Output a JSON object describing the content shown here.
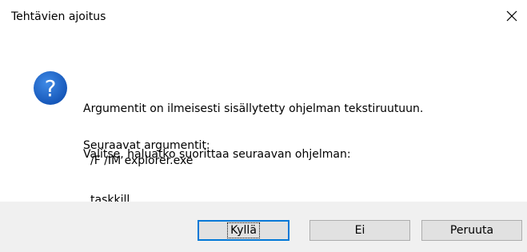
{
  "window": {
    "title": "Tehtävien ajoitus",
    "close_icon": "close-icon"
  },
  "message": {
    "icon": "question-icon",
    "line1": "Argumentit on ilmeisesti sisällytetty ohjelman tekstiruutuun.",
    "line2": "Valitse, haluatko suorittaa seuraavan ohjelman:",
    "program": "taskkill",
    "args_label": "Seuraavat argumentit:",
    "args_value": "/F /IM explorer.exe"
  },
  "buttons": {
    "yes": "Kyllä",
    "no": "Ei",
    "cancel": "Peruuta"
  },
  "colors": {
    "icon_blue": "#1f64c4",
    "default_border": "#0078d7",
    "footer_bg": "#f0f0f0",
    "button_bg": "#e1e1e1"
  }
}
